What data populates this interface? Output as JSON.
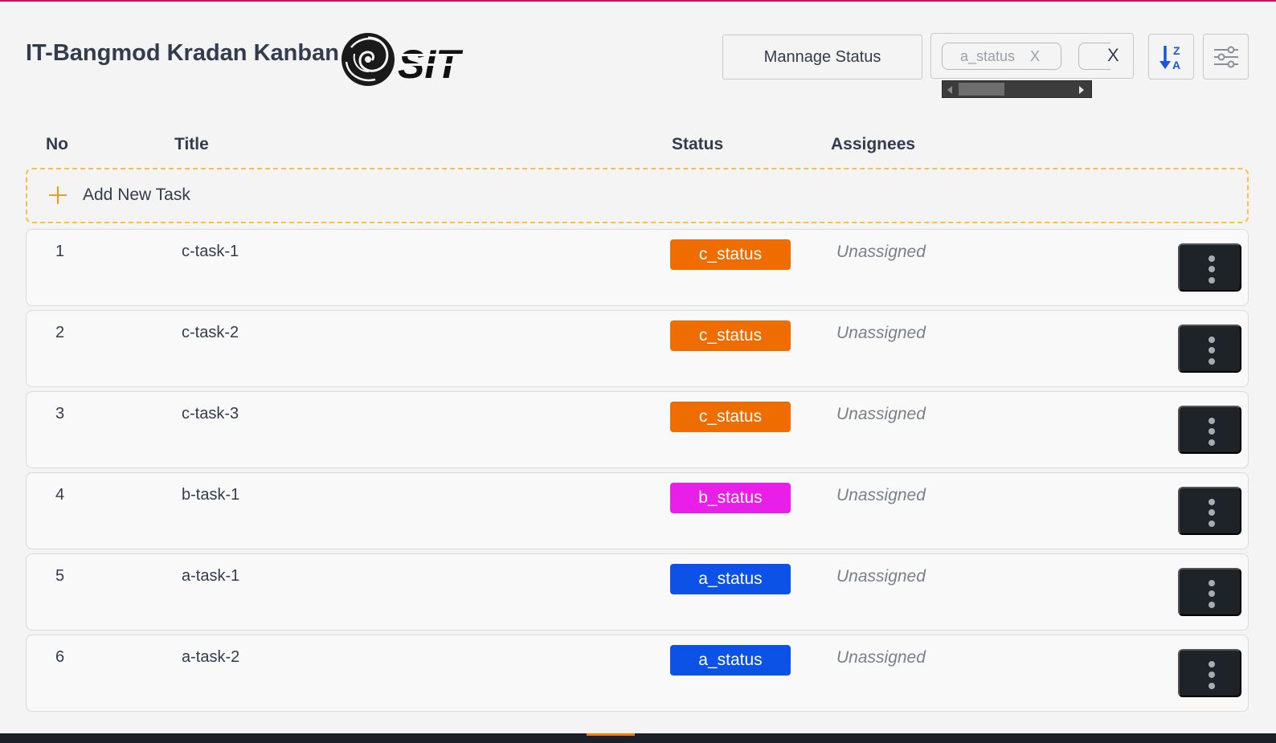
{
  "header": {
    "app_title": "IT-Bangmod Kradan Kanban",
    "logo": {
      "text": "SIT",
      "icon": "sit-logo"
    },
    "manage_status_label": "Mannage Status",
    "filter": {
      "chips": [
        {
          "label": "a_status",
          "remove_label": "X"
        }
      ],
      "clear_label": "X"
    },
    "sort_icon": "sort-z-to-a-icon",
    "settings_icon": "sliders-icon"
  },
  "table": {
    "columns": {
      "no": "No",
      "title": "Title",
      "status": "Status",
      "assignees": "Assignees"
    },
    "add_task_label": "Add New Task",
    "rows": [
      {
        "no": "1",
        "title": "c-task-1",
        "status": "c_status",
        "status_color": "#ef6c00",
        "assignees": "Unassigned"
      },
      {
        "no": "2",
        "title": "c-task-2",
        "status": "c_status",
        "status_color": "#ef6c00",
        "assignees": "Unassigned"
      },
      {
        "no": "3",
        "title": "c-task-3",
        "status": "c_status",
        "status_color": "#ef6c00",
        "assignees": "Unassigned"
      },
      {
        "no": "4",
        "title": "b-task-1",
        "status": "b_status",
        "status_color": "#e91ee9",
        "assignees": "Unassigned"
      },
      {
        "no": "5",
        "title": "a-task-1",
        "status": "a_status",
        "status_color": "#0d52e6",
        "assignees": "Unassigned"
      },
      {
        "no": "6",
        "title": "a-task-2",
        "status": "a_status",
        "status_color": "#0d52e6",
        "assignees": "Unassigned"
      }
    ]
  },
  "colors": {
    "accent_top": "#c2185b",
    "add_task_border": "#f5c242",
    "sort_icon": "#1a56db"
  }
}
